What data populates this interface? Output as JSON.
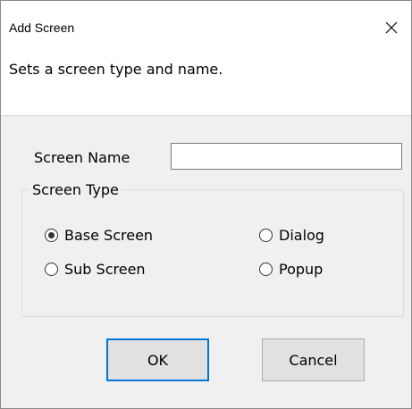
{
  "window": {
    "title": "Add Screen"
  },
  "header": {
    "description": "Sets a screen type and name."
  },
  "form": {
    "name_label": "Screen Name",
    "name_value": "",
    "type_group_label": "Screen Type",
    "options": [
      {
        "label": "Base Screen",
        "checked": true
      },
      {
        "label": "Dialog",
        "checked": false
      },
      {
        "label": "Sub Screen",
        "checked": false
      },
      {
        "label": "Popup",
        "checked": false
      }
    ]
  },
  "buttons": {
    "ok": "OK",
    "cancel": "Cancel"
  }
}
